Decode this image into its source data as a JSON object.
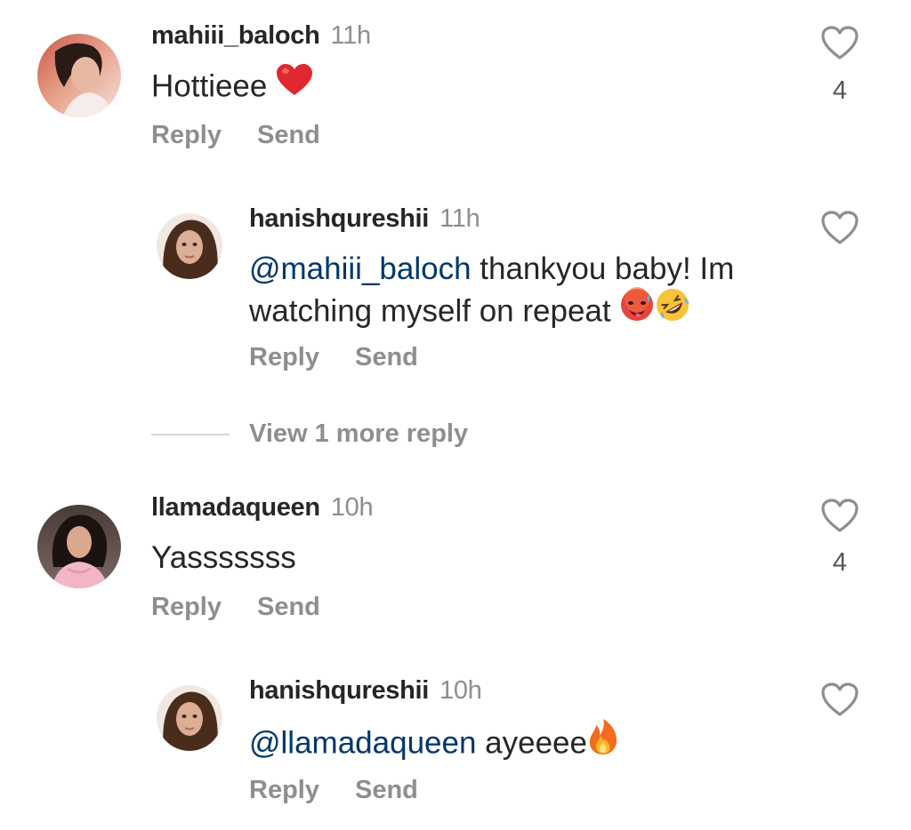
{
  "comments": [
    {
      "username": "mahiii_baloch",
      "time": "11h",
      "text": "Hottieee",
      "emoji": [
        "red-heart"
      ],
      "likes": "4",
      "reply_label": "Reply",
      "send_label": "Send",
      "replies": [
        {
          "username": "hanishqureshii",
          "time": "11h",
          "mention": "@mahiii_baloch",
          "text_line1": " thankyou baby! Im",
          "text_line2": "watching myself on repeat ",
          "emoji": [
            "hot-face",
            "rolling-laughing-face"
          ],
          "reply_label": "Reply",
          "send_label": "Send"
        }
      ],
      "view_more_label": "View 1 more reply"
    },
    {
      "username": "llamadaqueen",
      "time": "10h",
      "text": "Yasssssss",
      "likes": "4",
      "reply_label": "Reply",
      "send_label": "Send",
      "replies": [
        {
          "username": "hanishqureshii",
          "time": "10h",
          "mention": "@llamadaqueen",
          "text_line1": " ayeeee",
          "emoji": [
            "fire"
          ],
          "reply_label": "Reply",
          "send_label": "Send"
        }
      ]
    }
  ],
  "colors": {
    "text": "#262626",
    "muted": "#8e8e8e",
    "mention": "#00376b",
    "heart_outline": "#8e8e8e"
  },
  "icons": [
    "heart-outline-icon",
    "avatar-image"
  ]
}
